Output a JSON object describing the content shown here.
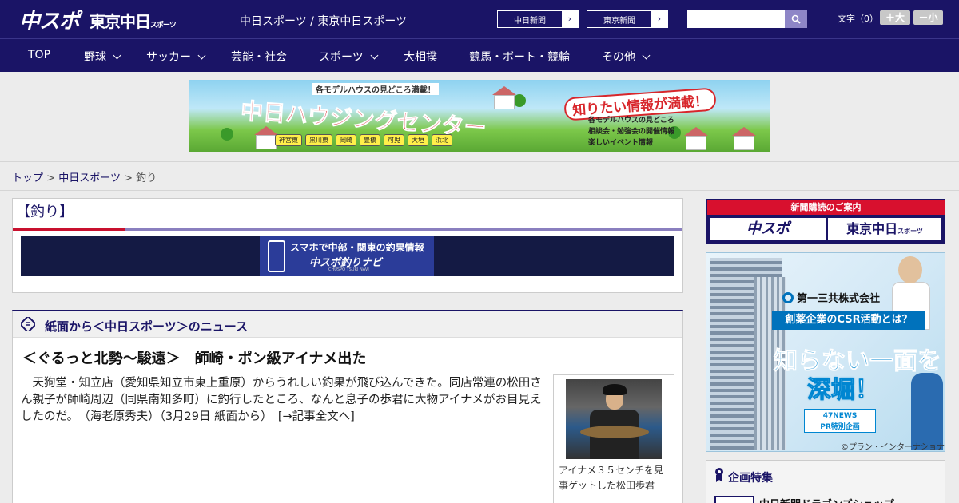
{
  "header": {
    "logo_main": "中スポ",
    "logo_sub": "東京中日",
    "logo_sub_small": "スポーツ",
    "site_title": "中日スポーツ / 東京中日スポーツ",
    "ext_links": [
      {
        "label": "中日新聞"
      },
      {
        "label": "東京新聞"
      }
    ],
    "search_placeholder": "",
    "fontsize_label": "文字（0）",
    "font_larger": "＋大",
    "font_smaller": "－小"
  },
  "nav": {
    "items": [
      {
        "label": "TOP",
        "has_dropdown": false
      },
      {
        "label": "野球",
        "has_dropdown": true
      },
      {
        "label": "サッカー",
        "has_dropdown": true
      },
      {
        "label": "芸能・社会",
        "has_dropdown": false
      },
      {
        "label": "スポーツ",
        "has_dropdown": true
      },
      {
        "label": "大相撲",
        "has_dropdown": false
      },
      {
        "label": "競馬・ボート・競輪",
        "has_dropdown": false
      },
      {
        "label": "その他",
        "has_dropdown": true
      }
    ]
  },
  "top_ad": {
    "tagline": "各モデルハウスの見どころ満載！",
    "main": "中日ハウジングセンター",
    "right_title": "知りたい情報が満載！",
    "info": [
      "各モデルハウスの見どころ",
      "相談会・勉強会の開催情報",
      "楽しいイベント情報"
    ],
    "cities": [
      "神宮東",
      "黒川東",
      "岡崎",
      "豊橋",
      "可児",
      "大垣",
      "浜北"
    ]
  },
  "breadcrumb": {
    "home": "トップ",
    "parent": "中日スポーツ",
    "current": "釣り",
    "sep": ">"
  },
  "section": {
    "title": "【釣り】",
    "navi_banner": {
      "line1": "スマホで中部・関東の釣果情報",
      "line2": "中スポ釣りナビ",
      "line3": "CHUSPO TSURI NAVI"
    }
  },
  "news": {
    "heading": "紙面から＜中日スポーツ＞のニュース",
    "article_title": "＜ぐるっと北勢～駿遠＞　師崎・ポン級アイナメ出た",
    "article_body": "天狗堂・知立店（愛知県知立市東上重原）からうれしい釣果が飛び込んできた。同店常連の松田さん親子が師崎周辺（同県南知多町）に釣行したところ、なんと息子の歩君に大物アイナメがお目見えしたのだ。　（海老原秀夫）（3月29日 紙面から）",
    "more_link": "[→記事全文へ]",
    "photo_caption": "アイナメ３５センチを見事ゲットした松田歩君"
  },
  "sidebar": {
    "subscribe_head": "新聞購読のご案内",
    "subscribe_logo1": "中スポ",
    "subscribe_logo2": "東京中日",
    "subscribe_logo2_small": "スポーツ",
    "csr_ad": {
      "company": "第一三共株式会社",
      "subtitle": "創薬企業のCSR活動とは？",
      "main1": "知らない一面を",
      "main2": "深堀！",
      "badge1": "47NEWS",
      "badge2": "PR特別企画",
      "credit": "©プラン・インターナショナル"
    },
    "feature_title": "企画特集",
    "feature_item": "中日新聞ドラゴンズショップ"
  },
  "colors": {
    "brand": "#1a1466",
    "accent_red": "#c8102e",
    "nav_bg": "#1a1466"
  }
}
